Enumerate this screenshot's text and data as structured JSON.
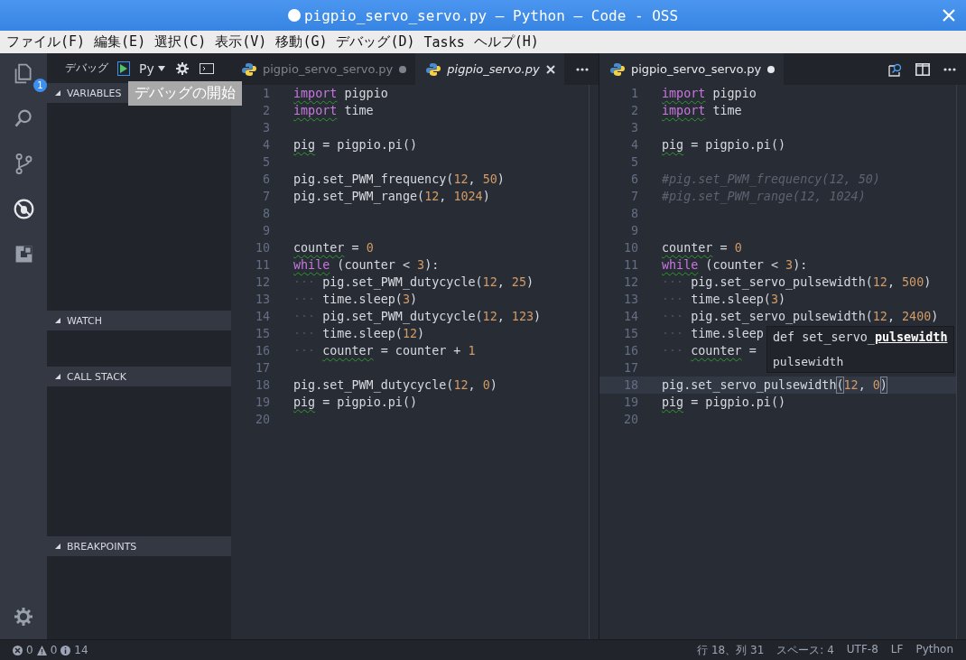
{
  "window": {
    "title": "pigpio_servo_servo.py — Python — Code - OSS",
    "dirty": true
  },
  "menu": [
    "ファイル(F)",
    "編集(E)",
    "選択(C)",
    "表示(V)",
    "移動(G)",
    "デバッグ(D)",
    "Tasks",
    "ヘルプ(H)"
  ],
  "activity_bar": [
    {
      "kind": "explorer",
      "selected": false,
      "badge": "1"
    },
    {
      "kind": "search",
      "selected": false
    },
    {
      "kind": "scm",
      "selected": false
    },
    {
      "kind": "debug",
      "selected": true
    },
    {
      "kind": "extensions",
      "selected": false
    }
  ],
  "debug_toolbar": {
    "label": "デバッグ",
    "config": "Py",
    "tooltip": "デバッグの開始"
  },
  "sidebar": {
    "sections": [
      {
        "title": "VARIABLES",
        "expanded": true
      },
      {
        "title": "WATCH",
        "expanded": true
      },
      {
        "title": "CALL STACK",
        "expanded": true
      },
      {
        "title": "BREAKPOINTS",
        "expanded": true
      }
    ]
  },
  "editors": [
    {
      "tabs": [
        {
          "label": "pigpio_servo_servo.py",
          "selected": false,
          "dirty": true,
          "preview": false
        },
        {
          "label": "pigpio_servo.py",
          "selected": true,
          "dirty": false,
          "preview": true
        }
      ],
      "lines": [
        {
          "no": "1",
          "current": false,
          "tokens": [
            {
              "kind": "kwlint",
              "text": "import"
            },
            {
              "kind": "plain",
              "text": " pigpio"
            }
          ]
        },
        {
          "no": "2",
          "current": false,
          "tokens": [
            {
              "kind": "kwlint",
              "text": "import"
            },
            {
              "kind": "plain",
              "text": " time"
            }
          ]
        },
        {
          "no": "3",
          "current": false
        },
        {
          "no": "4",
          "current": false,
          "tokens": [
            {
              "kind": "idlint",
              "text": "pig"
            },
            {
              "kind": "plain",
              "text": " = pigpio.pi()"
            }
          ]
        },
        {
          "no": "5",
          "current": false
        },
        {
          "no": "6",
          "current": false,
          "tokens": [
            {
              "kind": "plain",
              "text": "pig.set_PWM_frequency("
            },
            {
              "kind": "num",
              "text": "12"
            },
            {
              "kind": "plain",
              "text": ", "
            },
            {
              "kind": "num",
              "text": "50"
            },
            {
              "kind": "plain",
              "text": ")"
            }
          ]
        },
        {
          "no": "7",
          "current": false,
          "tokens": [
            {
              "kind": "plain",
              "text": "pig.set_PWM_range("
            },
            {
              "kind": "num",
              "text": "12"
            },
            {
              "kind": "plain",
              "text": ", "
            },
            {
              "kind": "num",
              "text": "1024"
            },
            {
              "kind": "plain",
              "text": ")"
            }
          ]
        },
        {
          "no": "8",
          "current": false
        },
        {
          "no": "9",
          "current": false
        },
        {
          "no": "10",
          "current": false,
          "tokens": [
            {
              "kind": "idlint",
              "text": "counter"
            },
            {
              "kind": "plain",
              "text": " = "
            },
            {
              "kind": "num",
              "text": "0"
            }
          ]
        },
        {
          "no": "11",
          "current": false,
          "tokens": [
            {
              "kind": "kwlint",
              "text": "while"
            },
            {
              "kind": "plain",
              "text": " (counter < "
            },
            {
              "kind": "num",
              "text": "3"
            },
            {
              "kind": "plain",
              "text": "):"
            }
          ]
        },
        {
          "no": "12",
          "current": false,
          "tokens": [
            {
              "kind": "guide",
              "text": "···"
            },
            {
              "kind": "plain",
              "text": "pig.set_PWM_dutycycle("
            },
            {
              "kind": "num",
              "text": "12"
            },
            {
              "kind": "plain",
              "text": ", "
            },
            {
              "kind": "num",
              "text": "25"
            },
            {
              "kind": "plain",
              "text": ")"
            }
          ]
        },
        {
          "no": "13",
          "current": false,
          "tokens": [
            {
              "kind": "guide",
              "text": "···"
            },
            {
              "kind": "plain",
              "text": "time.sleep("
            },
            {
              "kind": "num",
              "text": "3"
            },
            {
              "kind": "plain",
              "text": ")"
            }
          ]
        },
        {
          "no": "14",
          "current": false,
          "tokens": [
            {
              "kind": "guide",
              "text": "···"
            },
            {
              "kind": "plain",
              "text": "pig.set_PWM_dutycycle("
            },
            {
              "kind": "num",
              "text": "12"
            },
            {
              "kind": "plain",
              "text": ", "
            },
            {
              "kind": "num",
              "text": "123"
            },
            {
              "kind": "plain",
              "text": ")"
            }
          ]
        },
        {
          "no": "15",
          "current": false,
          "tokens": [
            {
              "kind": "guide",
              "text": "···"
            },
            {
              "kind": "plain",
              "text": "time.sleep("
            },
            {
              "kind": "num",
              "text": "12"
            },
            {
              "kind": "plain",
              "text": ")"
            }
          ]
        },
        {
          "no": "16",
          "current": false,
          "tokens": [
            {
              "kind": "guide",
              "text": "···"
            },
            {
              "kind": "idlint",
              "text": "counter"
            },
            {
              "kind": "plain",
              "text": " = counter + "
            },
            {
              "kind": "num",
              "text": "1"
            }
          ]
        },
        {
          "no": "17",
          "current": false
        },
        {
          "no": "18",
          "current": false,
          "tokens": [
            {
              "kind": "plain",
              "text": "pig.set_PWM_dutycycle("
            },
            {
              "kind": "num",
              "text": "12"
            },
            {
              "kind": "plain",
              "text": ", "
            },
            {
              "kind": "num",
              "text": "0"
            },
            {
              "kind": "plain",
              "text": ")"
            }
          ]
        },
        {
          "no": "19",
          "current": false,
          "tokens": [
            {
              "kind": "idlint",
              "text": "pig"
            },
            {
              "kind": "plain",
              "text": " = pigpio.pi()"
            }
          ]
        },
        {
          "no": "20",
          "current": false
        }
      ]
    },
    {
      "tabs": [
        {
          "label": "pigpio_servo_servo.py",
          "selected": true,
          "dirty": true,
          "preview": false
        }
      ],
      "lines": [
        {
          "no": "1",
          "current": false,
          "tokens": [
            {
              "kind": "kwlint",
              "text": "import"
            },
            {
              "kind": "plain",
              "text": " pigpio"
            }
          ]
        },
        {
          "no": "2",
          "current": false,
          "tokens": [
            {
              "kind": "kwlint",
              "text": "import"
            },
            {
              "kind": "plain",
              "text": " time"
            }
          ]
        },
        {
          "no": "3",
          "current": false
        },
        {
          "no": "4",
          "current": false,
          "tokens": [
            {
              "kind": "idlint",
              "text": "pig"
            },
            {
              "kind": "plain",
              "text": " = pigpio.pi()"
            }
          ]
        },
        {
          "no": "5",
          "current": false
        },
        {
          "no": "6",
          "current": false,
          "tokens": [
            {
              "kind": "comment",
              "text": "#pig.set_PWM_frequency(12, 50)"
            }
          ]
        },
        {
          "no": "7",
          "current": false,
          "tokens": [
            {
              "kind": "comment",
              "text": "#pig.set_PWM_range(12, 1024)"
            }
          ]
        },
        {
          "no": "8",
          "current": false
        },
        {
          "no": "9",
          "current": false
        },
        {
          "no": "10",
          "current": false,
          "tokens": [
            {
              "kind": "idlint",
              "text": "counter"
            },
            {
              "kind": "plain",
              "text": " = "
            },
            {
              "kind": "num",
              "text": "0"
            }
          ]
        },
        {
          "no": "11",
          "current": false,
          "tokens": [
            {
              "kind": "kwlint",
              "text": "while"
            },
            {
              "kind": "plain",
              "text": " (counter < "
            },
            {
              "kind": "num",
              "text": "3"
            },
            {
              "kind": "plain",
              "text": "):"
            }
          ]
        },
        {
          "no": "12",
          "current": false,
          "tokens": [
            {
              "kind": "guide",
              "text": "···"
            },
            {
              "kind": "plain",
              "text": "pig.set_servo_pulsewidth("
            },
            {
              "kind": "num",
              "text": "12"
            },
            {
              "kind": "plain",
              "text": ", "
            },
            {
              "kind": "num",
              "text": "500"
            },
            {
              "kind": "plain",
              "text": ")"
            }
          ]
        },
        {
          "no": "13",
          "current": false,
          "tokens": [
            {
              "kind": "guide",
              "text": "···"
            },
            {
              "kind": "plain",
              "text": "time.sleep("
            },
            {
              "kind": "num",
              "text": "3"
            },
            {
              "kind": "plain",
              "text": ")"
            }
          ]
        },
        {
          "no": "14",
          "current": false,
          "tokens": [
            {
              "kind": "guide",
              "text": "···"
            },
            {
              "kind": "plain",
              "text": "pig.set_servo_pulsewidth("
            },
            {
              "kind": "num",
              "text": "12"
            },
            {
              "kind": "plain",
              "text": ", "
            },
            {
              "kind": "num",
              "text": "2400"
            },
            {
              "kind": "plain",
              "text": ")"
            }
          ]
        },
        {
          "no": "15",
          "current": false,
          "tokens": [
            {
              "kind": "guide",
              "text": "···"
            },
            {
              "kind": "plain",
              "text": "time.sleep"
            }
          ]
        },
        {
          "no": "16",
          "current": false,
          "tokens": [
            {
              "kind": "guide",
              "text": "···"
            },
            {
              "kind": "idlint",
              "text": "counter"
            },
            {
              "kind": "plain",
              "text": " ="
            }
          ]
        },
        {
          "no": "17",
          "current": false
        },
        {
          "no": "18",
          "current": true,
          "tokens": [
            {
              "kind": "plain",
              "text": "pig.set_servo_pulsewidth"
            },
            {
              "kind": "bracket",
              "text": "("
            },
            {
              "kind": "num",
              "text": "12"
            },
            {
              "kind": "plain",
              "text": ", "
            },
            {
              "kind": "num",
              "text": "0"
            },
            {
              "kind": "bracket",
              "text": ")"
            }
          ]
        },
        {
          "no": "19",
          "current": false,
          "tokens": [
            {
              "kind": "idlint",
              "text": "pig"
            },
            {
              "kind": "plain",
              "text": " = pigpio.pi()"
            }
          ]
        },
        {
          "no": "20",
          "current": false
        }
      ],
      "hover": {
        "signature": "def set_servo_**pulsewidth**",
        "doc": "pulsewidth"
      }
    }
  ],
  "status_bar": {
    "errors": "0",
    "warnings": "0",
    "infos": "14",
    "items": [
      "行 18、列 31",
      "スペース: 4",
      "UTF-8",
      "LF",
      "Python"
    ]
  }
}
